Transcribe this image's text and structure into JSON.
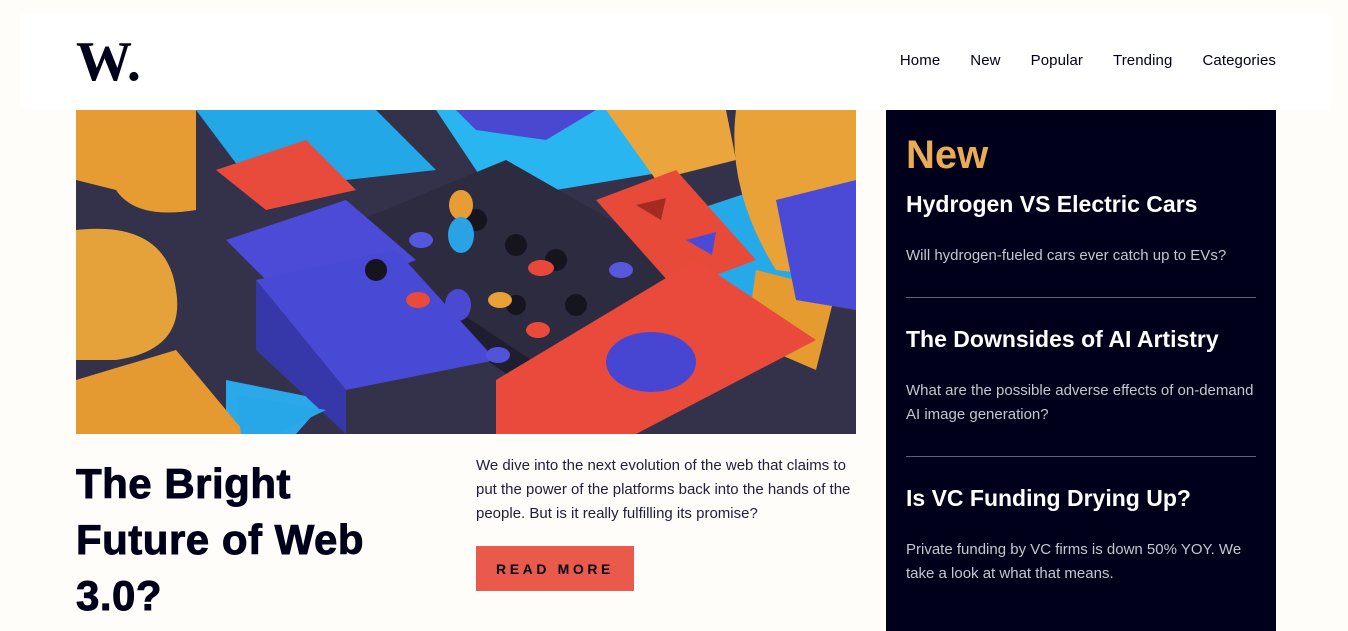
{
  "brand": {
    "logo_text": "W."
  },
  "nav": {
    "items": [
      "Home",
      "New",
      "Popular",
      "Trending",
      "Categories"
    ]
  },
  "hero": {
    "image_icon": "abstract-3d-blocks-illustration"
  },
  "article": {
    "headline": "The Bright Future of Web 3.0?",
    "lede": "We dive into the next evolution of the web that claims to put the power of the platforms back into the hands of the people. But is it really fulfilling its promise?",
    "cta": "READ MORE"
  },
  "sidebar": {
    "title": "New",
    "items": [
      {
        "title": "Hydrogen VS Electric Cars",
        "summary": "Will hydrogen-fueled cars ever catch up to EVs?"
      },
      {
        "title": "The Downsides of AI Artistry",
        "summary": "What are the possible adverse effects of on-demand AI image generation?"
      },
      {
        "title": "Is VC Funding Drying Up?",
        "summary": "Private funding by VC firms is down 50% YOY. We take a look at what that means."
      }
    ]
  },
  "colors": {
    "background": "#fffdfa",
    "dark": "#00001a",
    "accent_orange": "#e9ab53",
    "accent_red": "#ea5a4a",
    "muted": "#c5c6ce"
  }
}
